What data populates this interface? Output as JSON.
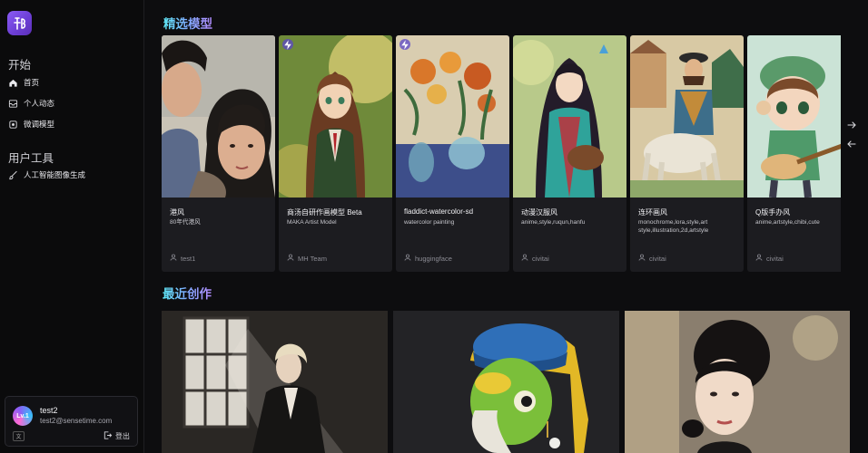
{
  "sidebar": {
    "groups": [
      {
        "title": "开始"
      },
      {
        "title": "用户工具"
      }
    ],
    "items": [
      {
        "label": "首页",
        "icon": "home-icon",
        "active": true
      },
      {
        "label": "个人动态",
        "icon": "inbox-icon"
      },
      {
        "label": "微调模型",
        "icon": "tune-icon"
      },
      {
        "label": "人工智能图像生成",
        "icon": "brush-icon"
      }
    ]
  },
  "user": {
    "level": "Lv.1",
    "name": "test2",
    "email": "test2@sensetime.com",
    "lang": "文",
    "logout_label": "登出"
  },
  "featured": {
    "title": "精选模型",
    "cards": [
      {
        "name": "港风",
        "tags": "80年代港风",
        "author": "test1",
        "badge": false
      },
      {
        "name": "商汤自研作画模型 Beta",
        "tags": "MAKA Artist Model",
        "author": "MH Team",
        "badge": true
      },
      {
        "name": "fladdict-watercolor-sd",
        "tags": "watercolor painting",
        "author": "huggingface",
        "badge": true
      },
      {
        "name": "动漫汉服风",
        "tags": "anime,style,ruqun,hanfu",
        "author": "civitai",
        "badge": false
      },
      {
        "name": "连环画风",
        "tags": "monochrome,lora,style,art style,illustration,2d,artstyle",
        "author": "civitai",
        "badge": false
      },
      {
        "name": "Q版手办风",
        "tags": "anime,artstyle,chibi,cute",
        "author": "civitai",
        "badge": false
      }
    ]
  },
  "recent": {
    "title": "最近创作"
  },
  "nav": {
    "next_icon": "arrow-right-icon",
    "prev_icon": "arrow-left-icon"
  },
  "colors": {
    "accent_gradient": [
      "#5ee7f5",
      "#7fa9ff",
      "#b38cff"
    ],
    "card_bg": "#1c1c20",
    "page_bg": "#0d0d0f"
  }
}
